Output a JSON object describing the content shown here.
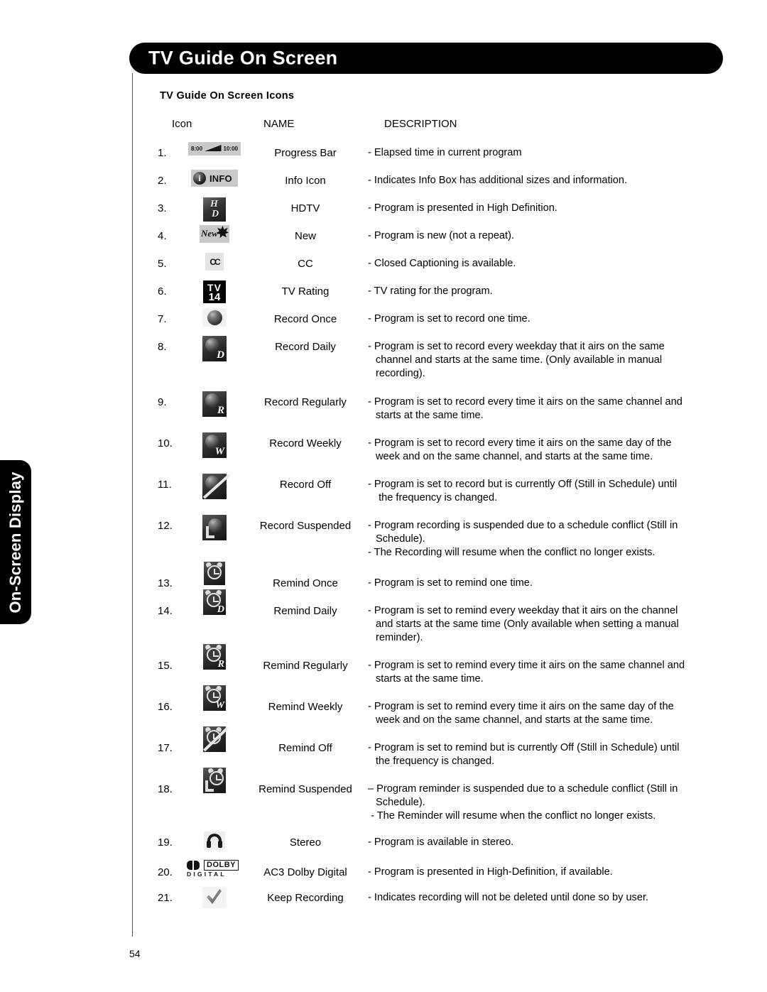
{
  "side_tab": {
    "label": "On-Screen Display"
  },
  "header": {
    "title": "TV Guide On Screen"
  },
  "section": {
    "heading": "TV Guide On Screen Icons"
  },
  "columns": {
    "icon": "Icon",
    "name": "NAME",
    "description": "DESCRIPTION"
  },
  "page_number": "54",
  "icon_labels": {
    "progress_start": "8:00",
    "progress_end": "10:00",
    "info": "INFO",
    "hd_h": "H",
    "hd_d": "D",
    "new": "New",
    "cc": "CC",
    "tv_top": "TV",
    "tv_bottom": "14",
    "record_daily": "D",
    "record_regularly": "R",
    "record_weekly": "W",
    "remind_daily": "D",
    "remind_regularly": "R",
    "remind_weekly": "W",
    "dolby_word": "DOLBY",
    "dolby_word2": "DIGITAL"
  },
  "rows": [
    {
      "num": "1.",
      "icon": "progress-bar-icon",
      "name": "Progress Bar",
      "desc": [
        "- Elapsed time in current program"
      ]
    },
    {
      "num": "2.",
      "icon": "info-icon",
      "name": "Info Icon",
      "desc": [
        "- Indicates Info Box has additional sizes and information."
      ]
    },
    {
      "num": "3.",
      "icon": "hdtv-icon",
      "name": "HDTV",
      "desc": [
        "- Program is presented in High Definition."
      ]
    },
    {
      "num": "4.",
      "icon": "new-icon",
      "name": "New",
      "desc": [
        "- Program is new (not a repeat)."
      ]
    },
    {
      "num": "5.",
      "icon": "closed-caption-icon",
      "name": "CC",
      "desc": [
        "- Closed Captioning is available."
      ]
    },
    {
      "num": "6.",
      "icon": "tv-rating-icon",
      "name": "TV Rating",
      "desc": [
        "- TV rating for the program."
      ]
    },
    {
      "num": "7.",
      "icon": "record-once-icon",
      "name": "Record Once",
      "desc": [
        "- Program is set to record one time."
      ]
    },
    {
      "num": "8.",
      "icon": "record-daily-icon",
      "name": "Record Daily",
      "desc": [
        "- Program is set to record every weekday that it airs on the same",
        "channel and starts at the same time. (Only available in manual",
        "recording)."
      ],
      "indent": [
        false,
        true,
        true
      ]
    },
    {
      "num": "9.",
      "icon": "record-regularly-icon",
      "name": "Record Regularly",
      "desc": [
        "- Program is set to record every time it airs on the same channel and",
        "starts at the same time."
      ],
      "indent": [
        false,
        true
      ]
    },
    {
      "num": "10.",
      "icon": "record-weekly-icon",
      "name": "Record Weekly",
      "desc": [
        "- Program is set to record every time it airs on the same day of the",
        "week and on the same channel, and starts at the same time."
      ],
      "indent": [
        false,
        true
      ]
    },
    {
      "num": "11.",
      "icon": "record-off-icon",
      "name": "Record Off",
      "desc": [
        "- Program is set to record but is currently Off (Still in Schedule) until",
        " the frequency is changed."
      ],
      "indent": [
        false,
        true
      ]
    },
    {
      "num": "12.",
      "icon": "record-suspended-icon",
      "name": "Record Suspended",
      "desc": [
        "- Program recording is suspended due to a schedule conflict (Still in",
        "Schedule).",
        "- The Recording will resume when the conflict no longer exists."
      ],
      "indent": [
        false,
        true,
        false
      ]
    },
    {
      "num": "13.",
      "icon": "remind-once-icon",
      "name": "Remind Once",
      "desc": [
        "- Program is set to remind one time."
      ]
    },
    {
      "num": "14.",
      "icon": "remind-daily-icon",
      "name": "Remind Daily",
      "desc": [
        "- Program is set to remind every weekday that it airs on the channel",
        "and starts at the same time (Only available when setting a manual",
        "reminder)."
      ],
      "indent": [
        false,
        true,
        true
      ]
    },
    {
      "num": "15.",
      "icon": "remind-regularly-icon",
      "name": "Remind Regularly",
      "desc": [
        "- Program is set to remind every time it airs on the same channel and",
        "starts at the same time."
      ],
      "indent": [
        false,
        true
      ]
    },
    {
      "num": "16.",
      "icon": "remind-weekly-icon",
      "name": "Remind Weekly",
      "desc": [
        "- Program is set to remind every time it airs on the same day of the",
        "week and on the same channel, and starts at the same time."
      ],
      "indent": [
        false,
        true
      ]
    },
    {
      "num": "17.",
      "icon": "remind-off-icon",
      "name": "Remind Off",
      "desc": [
        "- Program is set to remind but is currently Off (Still in Schedule) until",
        "the frequency is changed."
      ],
      "indent": [
        false,
        true
      ]
    },
    {
      "num": "18.",
      "icon": "remind-suspended-icon",
      "name": "Remind Suspended",
      "desc": [
        "– Program reminder is suspended due to a schedule conflict (Still in",
        "Schedule).",
        " - The Reminder will resume when the conflict no longer exists."
      ],
      "indent": [
        false,
        true,
        false
      ]
    },
    {
      "num": "19.",
      "icon": "stereo-icon",
      "name": "Stereo",
      "desc": [
        "- Program is available in stereo."
      ]
    },
    {
      "num": "20.",
      "icon": "dolby-digital-icon",
      "name": "AC3 Dolby Digital",
      "desc": [
        "- Program is presented in High-Definition, if available."
      ]
    },
    {
      "num": "21.",
      "icon": "keep-recording-icon",
      "name": "Keep Recording",
      "desc": [
        "- Indicates recording will not be deleted until done so by user."
      ]
    }
  ]
}
